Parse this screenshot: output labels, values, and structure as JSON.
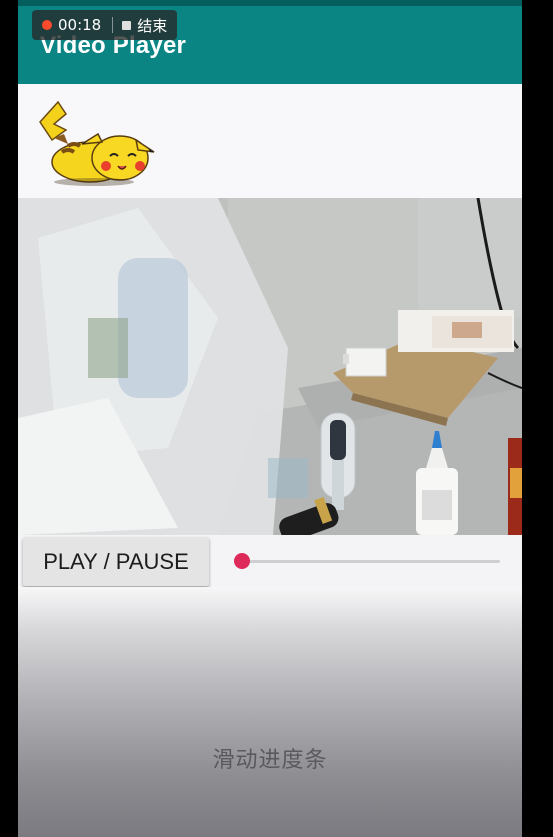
{
  "recording": {
    "time": "00:18",
    "end_label": "结束"
  },
  "app_bar": {
    "title": "Video Player"
  },
  "controls": {
    "play_pause_label": "PLAY / PAUSE",
    "seek_progress": 0.03
  },
  "hint": {
    "text": "滑动进度条"
  },
  "colors": {
    "app_bar": "#0b8584",
    "status_bar": "#045e5e",
    "accent": "#dd2a5b"
  }
}
